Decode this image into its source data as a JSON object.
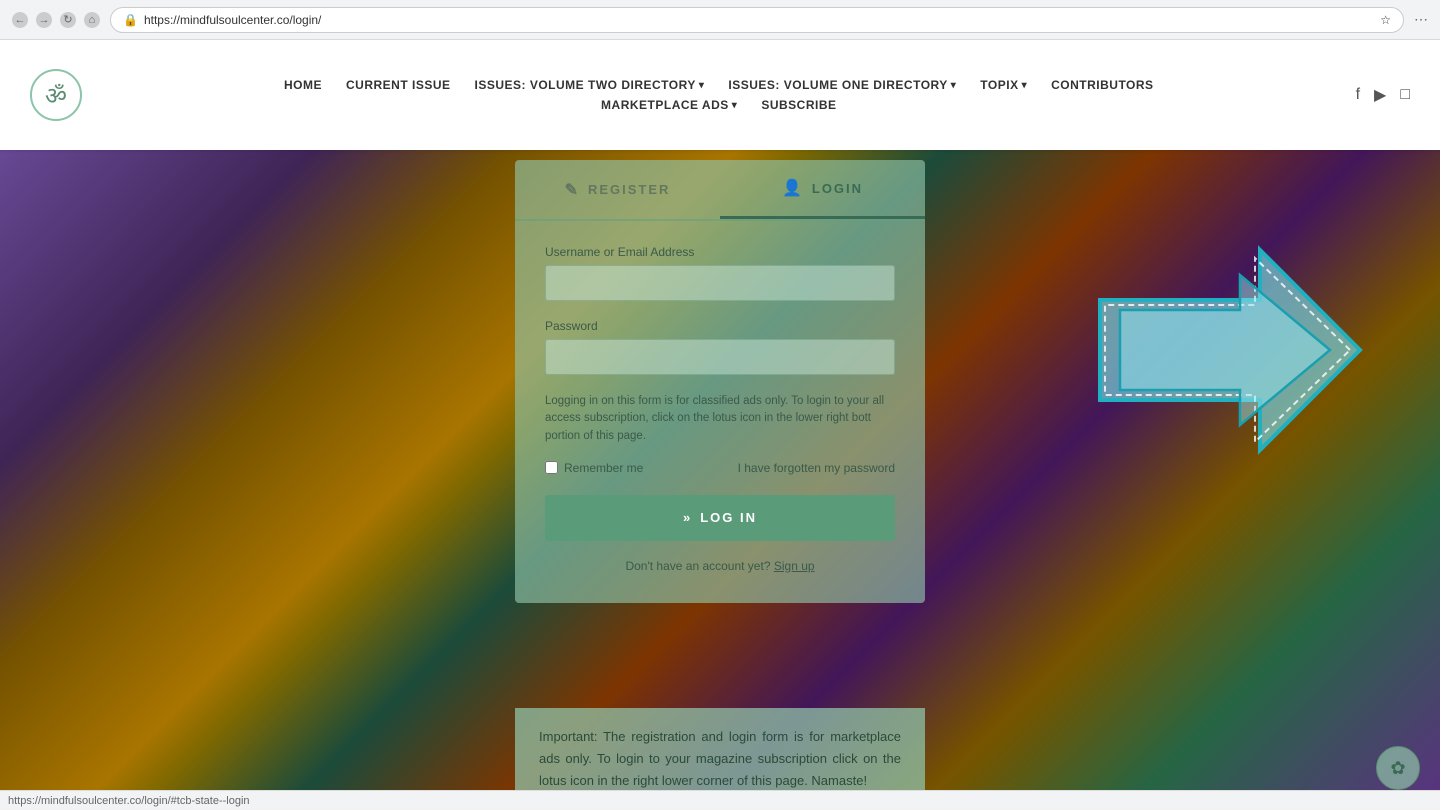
{
  "browser": {
    "url": "https://mindfulsoulcenter.co/login/",
    "favicon": "🔒"
  },
  "header": {
    "logo_symbol": "ॐ",
    "nav_row1": [
      {
        "label": "HOME",
        "has_dropdown": false
      },
      {
        "label": "CURRENT ISSUE",
        "has_dropdown": false
      },
      {
        "label": "ISSUES: VOLUME TWO DIRECTORY",
        "has_dropdown": true
      },
      {
        "label": "ISSUES: VOLUME ONE DIRECTORY",
        "has_dropdown": true
      },
      {
        "label": "TOPIX",
        "has_dropdown": true
      },
      {
        "label": "CONTRIBUTORS",
        "has_dropdown": false
      }
    ],
    "nav_row2": [
      {
        "label": "MARKETPLACE ADS",
        "has_dropdown": true
      },
      {
        "label": "SUBSCRIBE",
        "has_dropdown": false
      }
    ],
    "social_icons": [
      "facebook",
      "youtube",
      "instagram"
    ]
  },
  "modal": {
    "tabs": [
      {
        "label": "REGISTER",
        "icon": "✎",
        "active": false
      },
      {
        "label": "LOGIN",
        "icon": "👤",
        "active": true
      }
    ],
    "username_label": "Username or Email Address",
    "username_placeholder": "",
    "password_label": "Password",
    "password_placeholder": "",
    "notice_text": "Logging in on this form is for classified ads only. To login to your all access subscription, click on the lotus icon in the lower right bott portion of this page.",
    "remember_label": "Remember me",
    "forgot_label": "I have forgotten my password",
    "login_btn_label": "LOG IN",
    "login_btn_icon": "»",
    "signup_text": "Don't have an account yet?",
    "signup_link": "Sign up"
  },
  "bottom_notice": {
    "text": "Important: The registration and login form is for marketplace ads only.  To login to your magazine subscription click on the lotus icon in the right lower corner of this page. Namaste!"
  },
  "lotus_btn": {
    "symbol": "✿"
  },
  "status_bar": {
    "url": "https://mindfulsoulcenter.co/login/#tcb-state--login"
  }
}
